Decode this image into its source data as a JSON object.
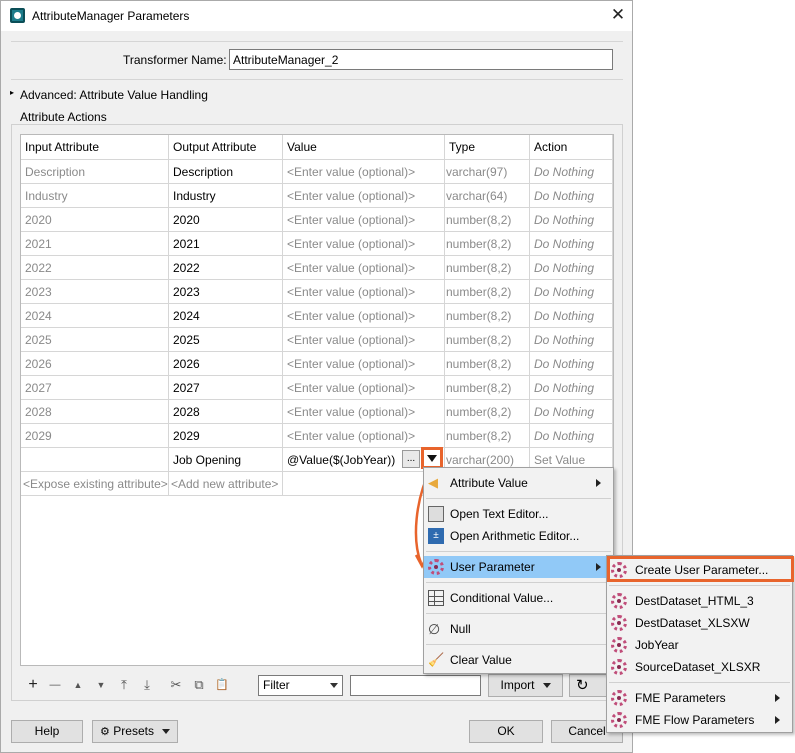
{
  "window": {
    "title": "AttributeManager Parameters",
    "close_glyph": "✕"
  },
  "transformer": {
    "label": "Transformer Name:",
    "value": "AttributeManager_2"
  },
  "advanced": {
    "label": "Advanced: Attribute Value Handling"
  },
  "actions_group": {
    "label": "Attribute Actions"
  },
  "table": {
    "headers": [
      "Input Attribute",
      "Output Attribute",
      "Value",
      "Type",
      "Action"
    ],
    "rows": [
      {
        "input": "Description",
        "output": "Description",
        "value": "<Enter value (optional)>",
        "type": "varchar(97)",
        "action": "Do Nothing"
      },
      {
        "input": "Industry",
        "output": "Industry",
        "value": "<Enter value (optional)>",
        "type": "varchar(64)",
        "action": "Do Nothing"
      },
      {
        "input": "2020",
        "output": "2020",
        "value": "<Enter value (optional)>",
        "type": "number(8,2)",
        "action": "Do Nothing"
      },
      {
        "input": "2021",
        "output": "2021",
        "value": "<Enter value (optional)>",
        "type": "number(8,2)",
        "action": "Do Nothing"
      },
      {
        "input": "2022",
        "output": "2022",
        "value": "<Enter value (optional)>",
        "type": "number(8,2)",
        "action": "Do Nothing"
      },
      {
        "input": "2023",
        "output": "2023",
        "value": "<Enter value (optional)>",
        "type": "number(8,2)",
        "action": "Do Nothing"
      },
      {
        "input": "2024",
        "output": "2024",
        "value": "<Enter value (optional)>",
        "type": "number(8,2)",
        "action": "Do Nothing"
      },
      {
        "input": "2025",
        "output": "2025",
        "value": "<Enter value (optional)>",
        "type": "number(8,2)",
        "action": "Do Nothing"
      },
      {
        "input": "2026",
        "output": "2026",
        "value": "<Enter value (optional)>",
        "type": "number(8,2)",
        "action": "Do Nothing"
      },
      {
        "input": "2027",
        "output": "2027",
        "value": "<Enter value (optional)>",
        "type": "number(8,2)",
        "action": "Do Nothing"
      },
      {
        "input": "2028",
        "output": "2028",
        "value": "<Enter value (optional)>",
        "type": "number(8,2)",
        "action": "Do Nothing"
      },
      {
        "input": "2029",
        "output": "2029",
        "value": "<Enter value (optional)>",
        "type": "number(8,2)",
        "action": "Do Nothing"
      }
    ],
    "new_row": {
      "input": "",
      "output": "Job Opening",
      "value": "@Value($(JobYear))",
      "ellipsis": "...",
      "type": "varchar(200)",
      "action": "Set Value"
    },
    "expose_row": {
      "input": "<Expose existing attribute>",
      "output": "<Add new attribute>"
    }
  },
  "toolbar": {
    "add": "+",
    "remove": "—",
    "move_up": "▲",
    "move_down": "▼",
    "move_top": "⤒",
    "move_bottom": "⤓",
    "cut": "✂",
    "copy": "⧉",
    "paste": "📋",
    "filter_label": "Filter",
    "filter_text": "",
    "import_label": "Import",
    "refresh": "↻"
  },
  "footer": {
    "help": "Help",
    "presets": "Presets",
    "ok": "OK",
    "cancel": "Cancel"
  },
  "context_menu": {
    "items": [
      {
        "label": "Attribute Value",
        "icon": "attribute-value-icon"
      },
      {
        "label": "Open Text Editor...",
        "icon": "text-editor-icon"
      },
      {
        "label": "Open Arithmetic Editor...",
        "icon": "arithmetic-editor-icon"
      },
      {
        "label": "User Parameter",
        "icon": "user-parameter-icon"
      },
      {
        "label": "Conditional Value...",
        "icon": "conditional-value-icon"
      },
      {
        "label": "Null",
        "icon": "null-icon"
      },
      {
        "label": "Clear Value",
        "icon": "clear-value-icon"
      }
    ]
  },
  "submenu": {
    "items": [
      {
        "label": "Create User Parameter..."
      },
      {
        "label": "DestDataset_HTML_3"
      },
      {
        "label": "DestDataset_XLSXW"
      },
      {
        "label": "JobYear"
      },
      {
        "label": "SourceDataset_XLSXR"
      },
      {
        "label": "FME Parameters"
      },
      {
        "label": "FME Flow Parameters"
      }
    ]
  },
  "colors": {
    "highlight_orange": "#e8642c",
    "menu_highlight": "#91c9f7"
  }
}
